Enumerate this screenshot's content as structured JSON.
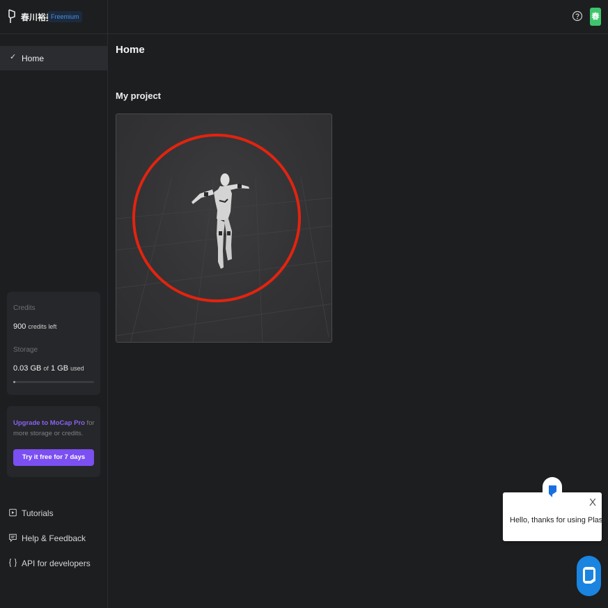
{
  "header": {
    "brand_name": "春川裕美",
    "plan_badge": "Freemium",
    "help_icon": "question-circle-icon",
    "avatar_initial": "春",
    "avatar_color": "#3ec46d"
  },
  "sidebar": {
    "nav": [
      {
        "label": "Home",
        "icon": "check-icon",
        "active": true
      }
    ],
    "usage": {
      "credits_label": "Credits",
      "credits_value": "900",
      "credits_suffix": "credits left",
      "storage_label": "Storage",
      "storage_used": "0.03 GB",
      "storage_of": "of",
      "storage_total": "1 GB",
      "storage_suffix": "used",
      "storage_fraction": 0.03
    },
    "upgrade": {
      "link_text": "Upgrade to MoCap Pro",
      "rest_text": " for more storage or credits.",
      "button_label": "Try it free for 7 days",
      "accent": "#7b4ff1"
    },
    "links": [
      {
        "label": "Tutorials",
        "icon": "play-square-icon"
      },
      {
        "label": "Help & Feedback",
        "icon": "message-square-icon"
      },
      {
        "label": "API for developers",
        "icon": "braces-icon"
      }
    ]
  },
  "main": {
    "page_title": "Home",
    "section_title": "My project",
    "project_thumbnail": "mannequin-3d-preview",
    "highlight_color": "#e3230f"
  },
  "chat": {
    "message": "Hello, thanks for using Plask",
    "close_label": "X",
    "launcher_color": "#1a84e0"
  }
}
